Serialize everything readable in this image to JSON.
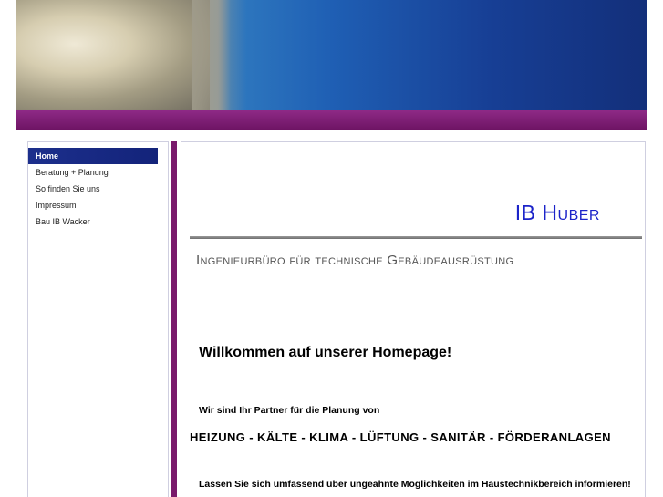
{
  "sidebar": {
    "items": [
      {
        "label": "Home",
        "active": true
      },
      {
        "label": "Beratung + Planung"
      },
      {
        "label": "So finden Sie uns"
      },
      {
        "label": "Impressum"
      },
      {
        "label": "Bau IB Wacker"
      }
    ]
  },
  "main": {
    "brand": "IB Huber",
    "subtitle": "Ingenieurbüro für technische Gebäudeausrüstung",
    "welcome": "Willkommen auf unserer Homepage!",
    "partner": "Wir sind Ihr Partner für die Planung von",
    "services": "HEIZUNG - KÄLTE - KLIMA - LÜFTUNG - SANITÄR - FÖRDERANLAGEN",
    "info": "Lassen Sie sich umfassend über ungeahnte Möglichkeiten im Haustechnikbereich informieren!"
  },
  "colors": {
    "accent_purple": "#7a1a6c",
    "nav_active": "#1c2f8c",
    "brand_blue": "#1c24c9"
  }
}
